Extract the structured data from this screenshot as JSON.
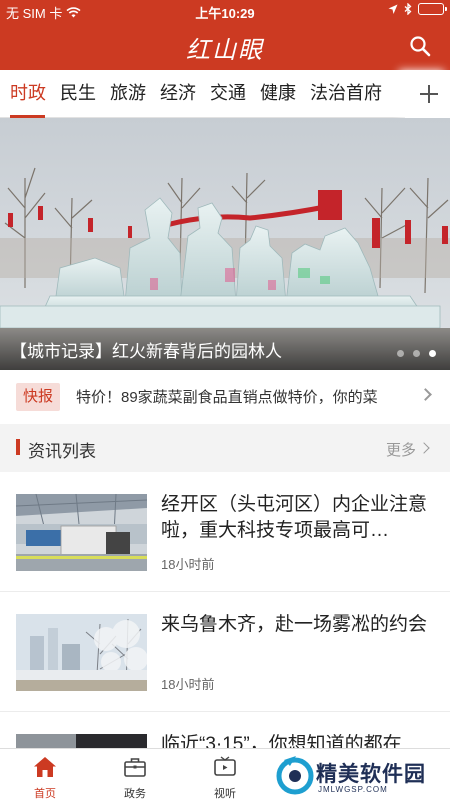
{
  "status_bar": {
    "carrier": "无 SIM 卡",
    "time": "上午10:29"
  },
  "header": {
    "logo_text": "红山眼",
    "search_icon": "search-icon"
  },
  "channel_tabs": {
    "items": [
      {
        "label": "时政",
        "active": true
      },
      {
        "label": "民生"
      },
      {
        "label": "旅游"
      },
      {
        "label": "经济"
      },
      {
        "label": "交通"
      },
      {
        "label": "健康"
      },
      {
        "label": "法治首府"
      }
    ],
    "add_icon": "plus-icon"
  },
  "banner": {
    "caption": "【城市记录】红火新春背后的园林人",
    "slide_count": 3,
    "active_slide": 3
  },
  "flash_news": {
    "badge": "快报",
    "text": "特价！89家蔬菜副食品直销点做特价，你的菜"
  },
  "section": {
    "title": "资讯列表",
    "more": "更多"
  },
  "news": [
    {
      "headline": "经开区（头屯河区）内企业注意啦，重大科技专项最高可…",
      "time": "18小时前"
    },
    {
      "headline": "来乌鲁木齐，赴一场雾凇的约会",
      "time": "18小时前"
    },
    {
      "headline": "临近“3·15”，你想知道的都在",
      "time": ""
    }
  ],
  "tabbar": {
    "items": [
      {
        "label": "首页",
        "icon": "home-icon",
        "active": true
      },
      {
        "label": "政务",
        "icon": "briefcase-icon"
      },
      {
        "label": "视听",
        "icon": "tv-icon"
      }
    ]
  },
  "watermark": {
    "text": "精美软件园",
    "sub": "JMLWGSP.COM"
  },
  "colors": {
    "brand": "#cc3a22",
    "badge_bg": "#f6dcd8"
  }
}
